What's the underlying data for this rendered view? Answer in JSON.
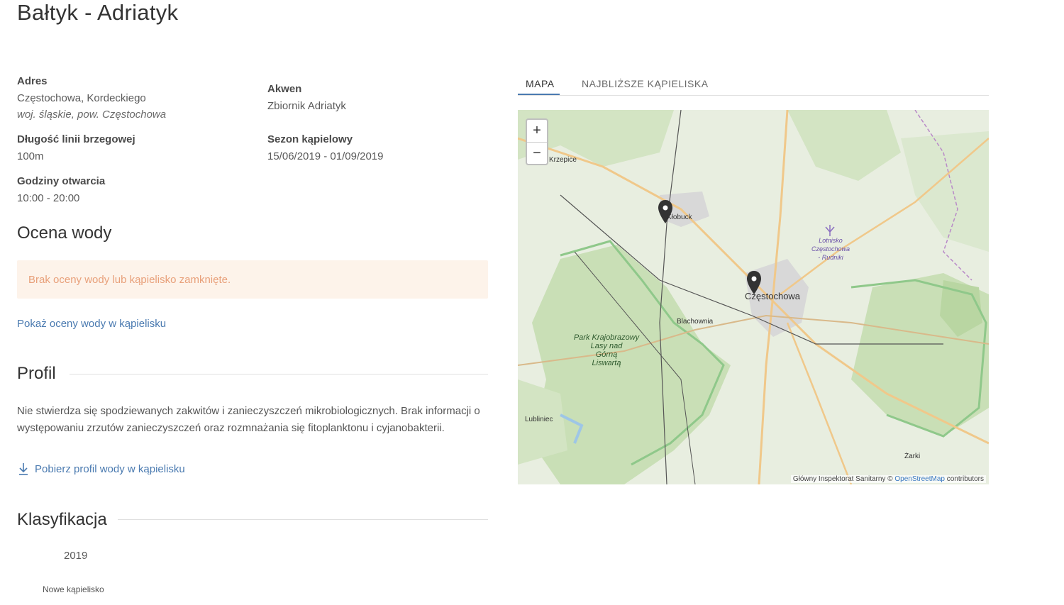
{
  "page": {
    "title": "Bałtyk - Adriatyk"
  },
  "details": {
    "address_label": "Adres",
    "address_line1": "Częstochowa, Kordeckiego",
    "address_line2": "woj. śląskie, pow. Częstochowa",
    "shore_label": "Długość linii brzegowej",
    "shore_value": "100m",
    "hours_label": "Godziny otwarcia",
    "hours_value": "10:00 - 20:00",
    "water_label": "Akwen",
    "water_value": "Zbiornik Adriatyk",
    "season_label": "Sezon kąpielowy",
    "season_value": "15/06/2019 - 01/09/2019"
  },
  "quality": {
    "heading": "Ocena wody",
    "alert_text": "Brak oceny wody lub kąpielisko zamknięte.",
    "link": "Pokaż oceny wody w kąpielisku"
  },
  "profile": {
    "heading": "Profil",
    "text": "Nie stwierdza się spodziewanych zakwitów i zanieczyszczeń mikrobiologicznych. Brak informacji o występowaniu zrzutów zanieczyszczeń oraz rozmnażania się fitoplanktonu i cyjanobakterii.",
    "download_link": "Pobierz profil wody w kąpielisku",
    "download_icon": "download-arrow-icon"
  },
  "classification": {
    "heading": "Klasyfikacja",
    "year": "2019",
    "status": "Nowe kąpielisko"
  },
  "tabs": [
    {
      "label": "MAPA",
      "active": true
    },
    {
      "label": "NAJBLIŻSZE KĄPIELISKA",
      "active": false
    }
  ],
  "map": {
    "zoom_in": "+",
    "zoom_out": "−",
    "labels": {
      "krzepice": "Krzepice",
      "klobuck": "Kłobuck",
      "czestochowa": "Częstochowa",
      "blachownia": "Blachownia",
      "park1": "Park Krajobrazowy",
      "park2": "Lasy nad",
      "park3": "Górną",
      "park4": "Liswartą",
      "lubliniec": "Lubliniec",
      "zarki": "Żarki",
      "airport1": "Lotnisko",
      "airport2": "Częstochowa",
      "airport3": "- Rudniki"
    },
    "attribution_prefix": "Główny Inspektorat Sanitarny © ",
    "attribution_link": "OpenStreetMap",
    "attribution_suffix": " contributors",
    "colors": {
      "land": "#e8eee0",
      "forest": "#c9dfb6",
      "road": "#f0c88a",
      "urban": "#d8d8d8",
      "border": "#8fc88a"
    }
  }
}
